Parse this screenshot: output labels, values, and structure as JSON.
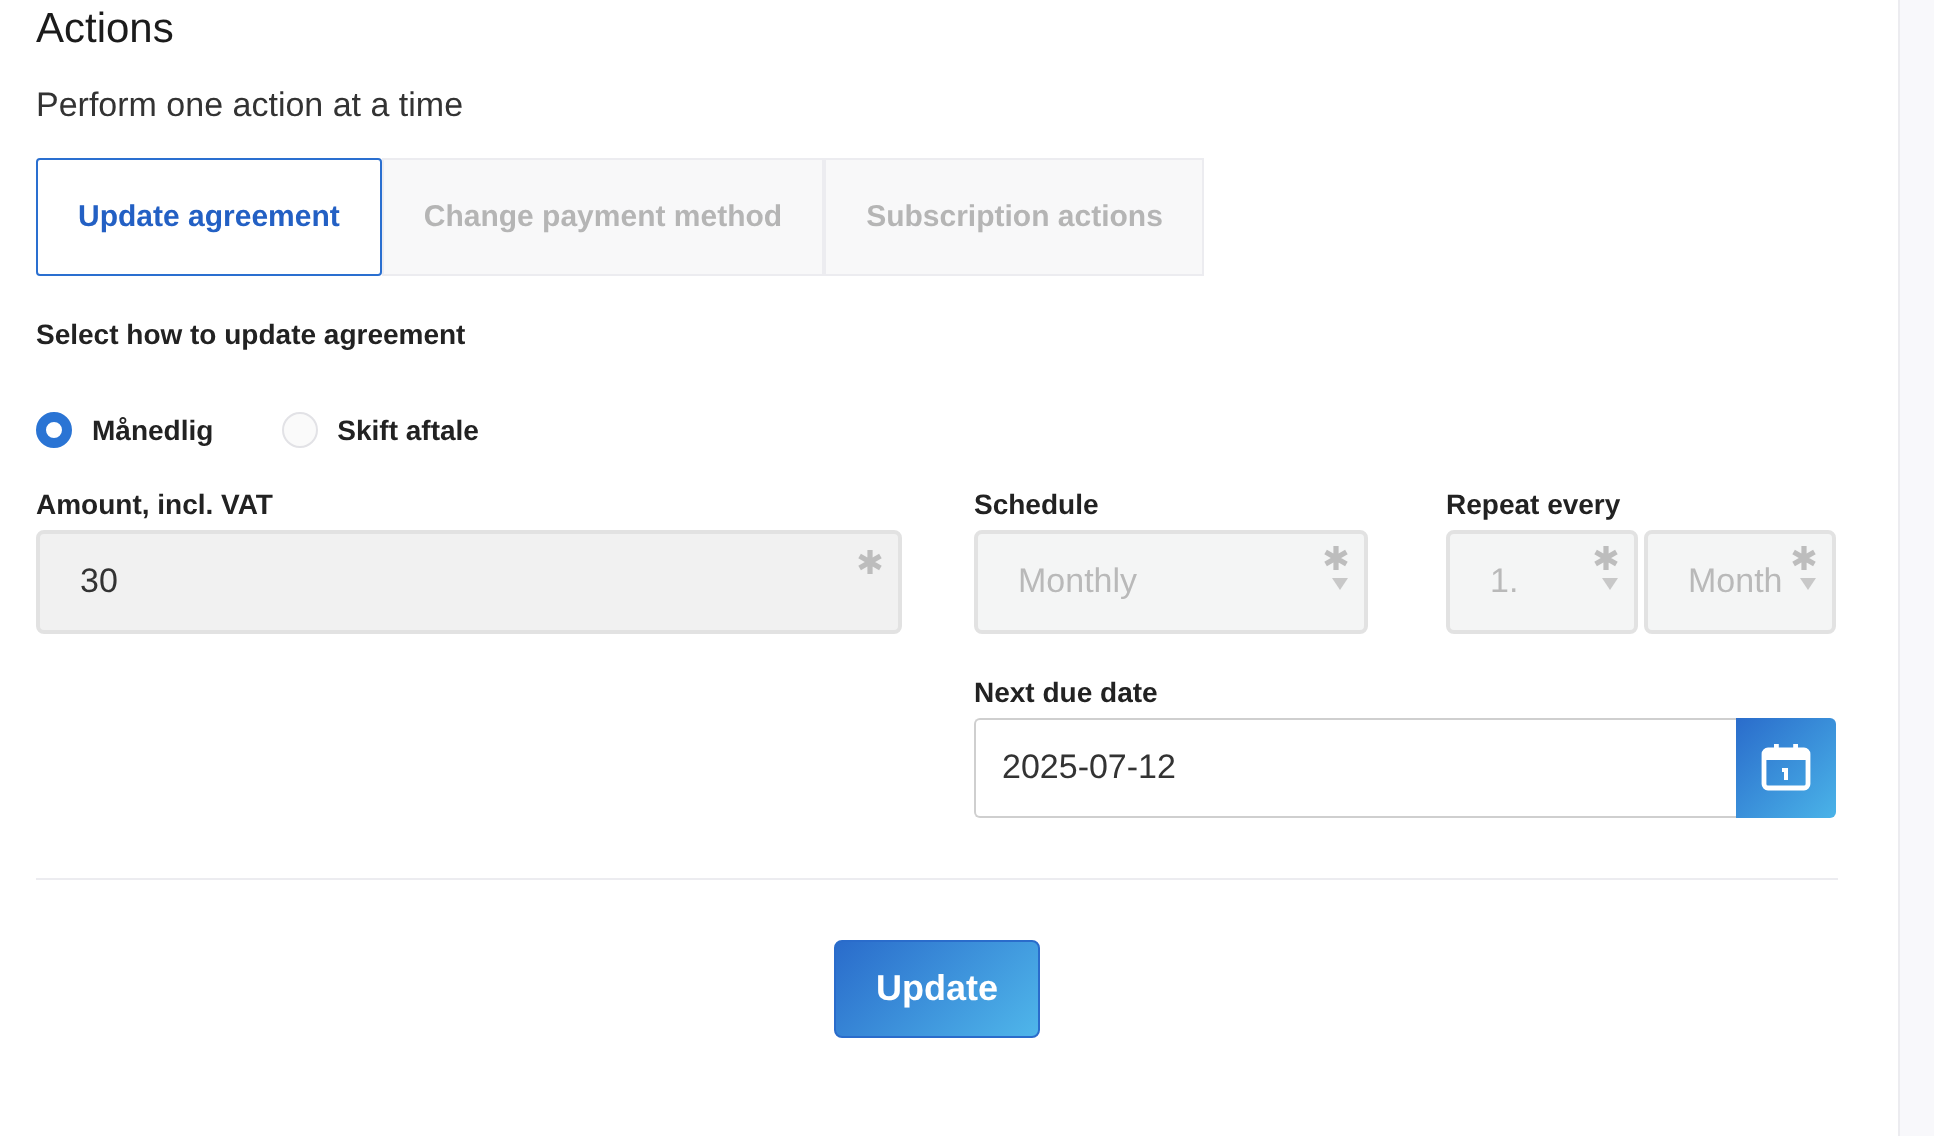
{
  "heading": "Actions",
  "subtitle": "Perform one action at a time",
  "tabs": [
    {
      "label": "Update agreement",
      "selected": true
    },
    {
      "label": "Change payment method",
      "selected": false
    },
    {
      "label": "Subscription actions",
      "selected": false
    }
  ],
  "prompt": "Select how to update agreement",
  "options": [
    {
      "label": "Månedlig",
      "selected": true
    },
    {
      "label": "Skift aftale",
      "selected": false
    }
  ],
  "amount": {
    "label": "Amount, incl. VAT",
    "value": "30",
    "required": true
  },
  "schedule": {
    "label": "Schedule",
    "value": "Monthly",
    "required": true,
    "disabled": true
  },
  "repeat": {
    "label": "Repeat every",
    "fields": [
      {
        "value": "1.",
        "required": true,
        "disabled": true
      },
      {
        "value": "Month",
        "required": true,
        "disabled": true
      }
    ]
  },
  "due_date": {
    "label": "Next due date",
    "value": "2025-07-12"
  },
  "submit": "Update"
}
